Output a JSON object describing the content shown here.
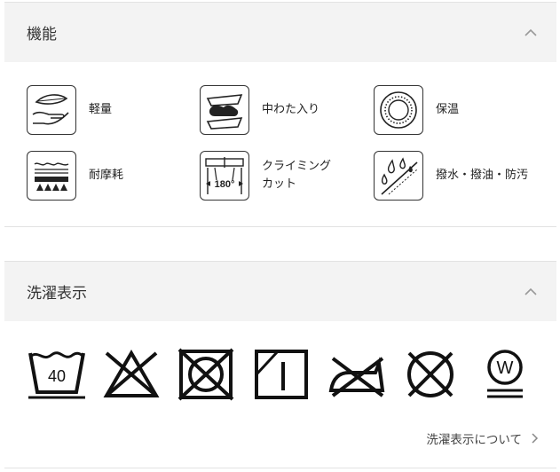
{
  "features_section": {
    "title": "機能",
    "items": [
      {
        "label": "軽量",
        "icon": "feather-hand-icon"
      },
      {
        "label": "中わた入り",
        "icon": "padding-icon"
      },
      {
        "label": "保温",
        "icon": "warmth-icon"
      },
      {
        "label": "耐摩耗",
        "icon": "abrasion-resistant-icon"
      },
      {
        "label": "クライミング\nカット",
        "icon": "climbing-cut-icon"
      },
      {
        "label": "撥水・撥油・防汚",
        "icon": "water-repellent-icon"
      }
    ]
  },
  "care_section": {
    "title": "洗濯表示",
    "symbols": [
      {
        "icon": "wash-40-icon",
        "value": "40"
      },
      {
        "icon": "no-bleach-icon"
      },
      {
        "icon": "no-tumble-dry-icon"
      },
      {
        "icon": "line-dry-shade-icon"
      },
      {
        "icon": "no-iron-icon"
      },
      {
        "icon": "no-dry-clean-icon"
      },
      {
        "icon": "wet-clean-icon",
        "value": "W"
      }
    ],
    "link_label": "洗濯表示について"
  }
}
